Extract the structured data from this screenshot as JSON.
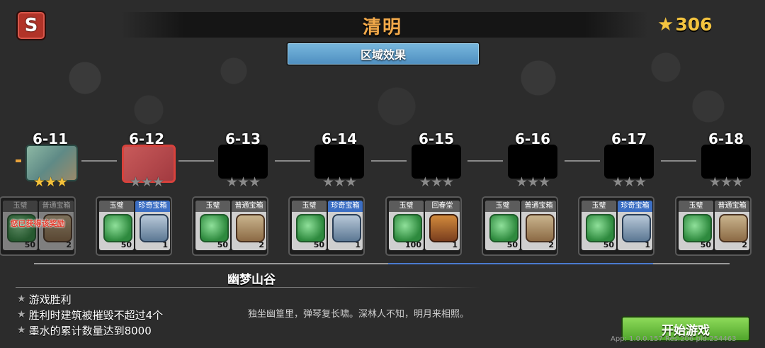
{
  "header": {
    "back_icon": "S",
    "title": "清明",
    "star_count": "306",
    "region_button": "区域效果"
  },
  "levels": [
    {
      "id": "6-11",
      "stars": 3,
      "state": "done",
      "rewards": [
        {
          "name": "玉璧",
          "count": "50",
          "icon": "jade"
        },
        {
          "name": "普通宝箱",
          "count": "2",
          "icon": "chest"
        }
      ],
      "claimed_text": "您已获得该奖励"
    },
    {
      "id": "6-12",
      "stars": 0,
      "state": "current",
      "rewards": [
        {
          "name": "玉璧",
          "count": "50",
          "icon": "jade"
        },
        {
          "name": "珍奇宝箱",
          "count": "1",
          "icon": "rare-chest"
        }
      ]
    },
    {
      "id": "6-13",
      "stars": 0,
      "state": "locked",
      "rewards": [
        {
          "name": "玉璧",
          "count": "50",
          "icon": "jade"
        },
        {
          "name": "普通宝箱",
          "count": "2",
          "icon": "chest"
        }
      ]
    },
    {
      "id": "6-14",
      "stars": 0,
      "state": "locked",
      "rewards": [
        {
          "name": "玉璧",
          "count": "50",
          "icon": "jade"
        },
        {
          "name": "珍奇宝箱",
          "count": "1",
          "icon": "rare-chest"
        }
      ]
    },
    {
      "id": "6-15",
      "stars": 0,
      "state": "locked",
      "rewards": [
        {
          "name": "玉璧",
          "count": "100",
          "icon": "jade"
        },
        {
          "name": "回春堂",
          "count": "1",
          "icon": "hall"
        }
      ]
    },
    {
      "id": "6-16",
      "stars": 0,
      "state": "locked",
      "rewards": [
        {
          "name": "玉璧",
          "count": "50",
          "icon": "jade"
        },
        {
          "name": "普通宝箱",
          "count": "2",
          "icon": "chest"
        }
      ]
    },
    {
      "id": "6-17",
      "stars": 0,
      "state": "locked",
      "rewards": [
        {
          "name": "玉璧",
          "count": "50",
          "icon": "jade"
        },
        {
          "name": "珍奇宝箱",
          "count": "1",
          "icon": "rare-chest"
        }
      ]
    },
    {
      "id": "6-18",
      "stars": 0,
      "state": "locked",
      "rewards": [
        {
          "name": "玉璧",
          "count": "50",
          "icon": "jade"
        },
        {
          "name": "普通宝箱",
          "count": "2",
          "icon": "chest"
        }
      ]
    }
  ],
  "area_name": "幽梦山谷",
  "objectives": [
    "游戏胜利",
    "胜利时建筑被摧毁不超过4个",
    "墨水的累计数量达到8000"
  ],
  "poem": "独坐幽篁里，弹琴复长啸。深林人不知，明月来相照。",
  "start_button": "开始游戏",
  "version_info": "App: 1.0.0.157 Res:206 pid:254463",
  "colors": {
    "title": "#f2a94a",
    "star": "#f3c33f",
    "start_button": "#6cc23f",
    "region_button": "#5f9fcf"
  }
}
